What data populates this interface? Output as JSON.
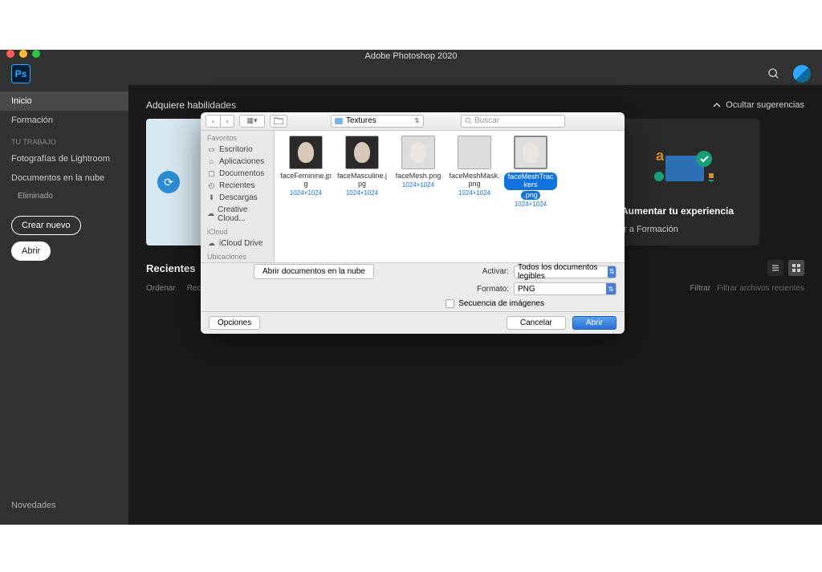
{
  "titlebar": "Adobe Photoshop 2020",
  "logo": "Ps",
  "sidebar": {
    "home": "Inicio",
    "learn": "Formación",
    "work_header": "TU TRABAJO",
    "lightroom": "Fotografías de Lightroom",
    "cloud_docs": "Documentos en la nube",
    "deleted": "Eliminado",
    "create": "Crear nuevo",
    "open": "Abrir",
    "news": "Novedades"
  },
  "main": {
    "acquire": "Adquiere habilidades",
    "hide": "Ocultar sugerencias",
    "enhance_title": "Aumentar tu experiencia",
    "enhance_link": "Ir a Formación",
    "recents": "Recientes",
    "sort": "Ordenar",
    "sort_by": "Recientes",
    "filter_label": "Filtrar",
    "filter_placeholder": "Filtrar archivos recientes"
  },
  "dialog": {
    "path": "Textures",
    "search_placeholder": "Buscar",
    "fav_header": "Favoritos",
    "fav": [
      "Escritorio",
      "Aplicaciones",
      "Documentos",
      "Recientes",
      "Descargas",
      "Creative Cloud..."
    ],
    "icloud_header": "iCloud",
    "icloud": "iCloud Drive",
    "loc_header": "Ubicaciones",
    "files": [
      {
        "name": "faceFeminine.jpg",
        "dim": "1024×1024",
        "thumb": "dark",
        "sel": false
      },
      {
        "name": "faceMasculine.jpg",
        "dim": "1024×1024",
        "thumb": "dark",
        "sel": false
      },
      {
        "name": "faceMesh.png",
        "dim": "1024×1024",
        "thumb": "light",
        "sel": false
      },
      {
        "name": "faceMeshMask.png",
        "dim": "1024×1024",
        "thumb": "white",
        "sel": false
      },
      {
        "name": "faceMeshTrackers.png",
        "dim": "1024×1024",
        "thumb": "light",
        "sel": true
      }
    ],
    "cloud_btn": "Abrir documentos en la nube",
    "activate_label": "Activar:",
    "activate_value": "Todos los documentos legibles",
    "format_label": "Formato:",
    "format_value": "PNG",
    "sequence": "Secuencia de imágenes",
    "options": "Opciones",
    "cancel": "Cancelar",
    "open": "Abrir"
  }
}
